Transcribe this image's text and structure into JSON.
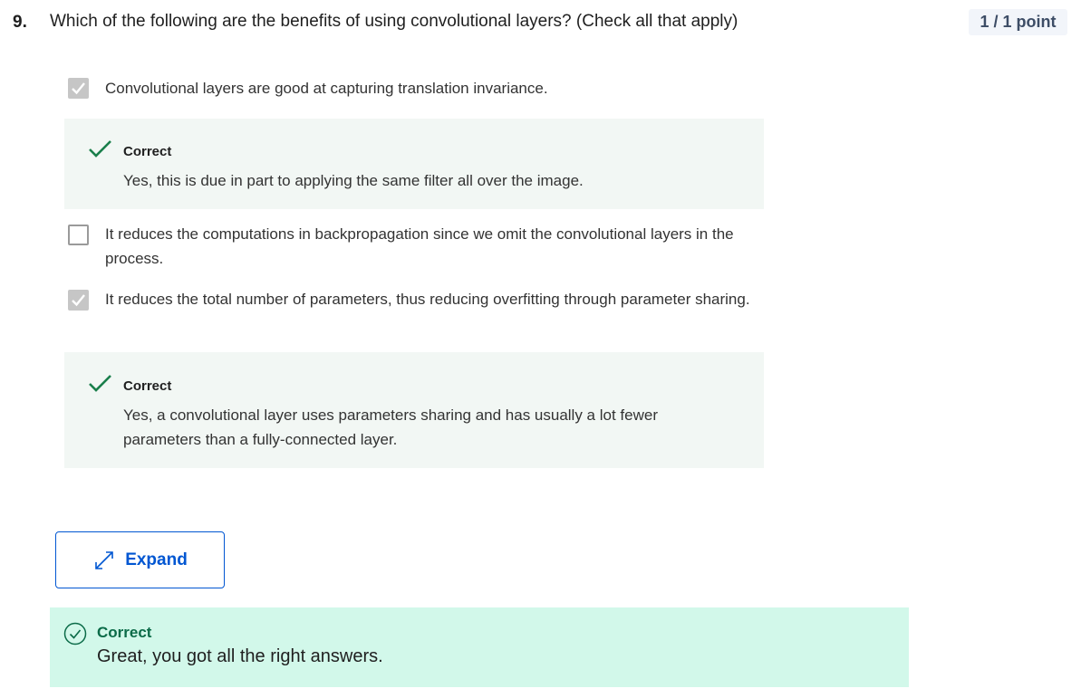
{
  "question": {
    "number": "9.",
    "text": "Which of the following are the benefits of using convolutional layers? (Check all that apply)",
    "points": "1 / 1 point"
  },
  "options": [
    {
      "text": "Convolutional layers are good at capturing translation invariance.",
      "checked": true,
      "feedback": {
        "label": "Correct",
        "text": "Yes, this is due in part to applying the same filter all over the image."
      }
    },
    {
      "text": "It reduces the computations in backpropagation since we omit the convolutional layers in the process.",
      "checked": false
    },
    {
      "text": "It reduces the total number of parameters, thus reducing overfitting through parameter sharing.",
      "checked": true,
      "feedback": {
        "label": "Correct",
        "text": "Yes, a convolutional layer uses parameters sharing and has usually a lot fewer parameters than a fully-connected layer."
      }
    }
  ],
  "expand_button": {
    "label": "Expand",
    "icon": "expand-arrows-icon"
  },
  "result": {
    "label": "Correct",
    "text": "Great, you got all the right answers.",
    "icon": "check-circle-icon"
  },
  "colors": {
    "accent_blue": "#0056d2",
    "success_green": "#1a7f4b",
    "result_bg": "#d2f8ea",
    "feedback_bg": "#f2f7f4"
  }
}
